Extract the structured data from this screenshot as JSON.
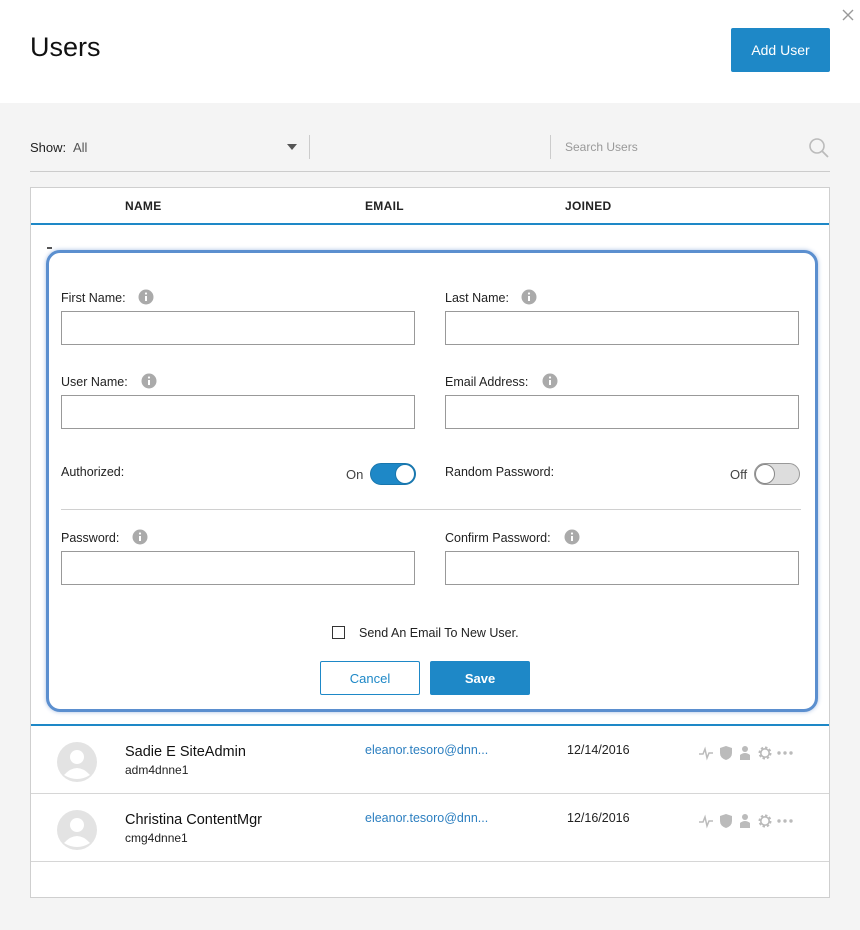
{
  "header": {
    "title": "Users",
    "add_user_label": "Add User"
  },
  "filter": {
    "show_label": "Show:",
    "show_value": "All",
    "search_placeholder": "Search Users"
  },
  "table": {
    "columns": [
      "NAME",
      "EMAIL",
      "JOINED"
    ]
  },
  "form": {
    "first_name_label": "First Name:",
    "last_name_label": "Last Name:",
    "user_name_label": "User Name:",
    "email_address_label": "Email Address:",
    "authorized_label": "Authorized:",
    "authorized_state": "On",
    "random_password_label": "Random Password:",
    "random_password_state": "Off",
    "password_label": "Password:",
    "confirm_password_label": "Confirm Password:",
    "send_email_label": "Send An Email To New User.",
    "cancel_label": "Cancel",
    "save_label": "Save"
  },
  "users": [
    {
      "name": "Sadie E SiteAdmin",
      "login": "adm4dnne1",
      "email": "eleanor.tesoro@dnn...",
      "joined": "12/14/2016"
    },
    {
      "name": "Christina ContentMgr",
      "login": "cmg4dnne1",
      "email": "eleanor.tesoro@dnn...",
      "joined": "12/16/2016"
    }
  ],
  "colors": {
    "accent": "#1e88c7",
    "highlight_border": "#5b8fcf",
    "link": "#2c7fc0"
  },
  "icons": [
    "close-icon",
    "search-icon",
    "info-icon",
    "avatar-icon",
    "activity-icon",
    "shield-icon",
    "person-icon",
    "gear-icon",
    "more-icon"
  ]
}
